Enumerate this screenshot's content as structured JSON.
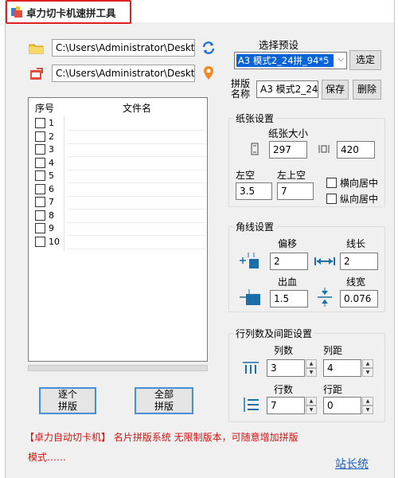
{
  "window": {
    "title": "卓力切卡机速拼工具"
  },
  "paths": {
    "input": "C:\\Users\\Administrator\\Desktop\\1",
    "output": "C:\\Users\\Administrator\\Desktop\\2"
  },
  "preset": {
    "label": "选择预设",
    "selected": "A3 模式2_24拼_94*5",
    "select_button": "选定",
    "name_label_1": "拼版",
    "name_label_2": "名称",
    "name_value": "A3 模式2_24",
    "save_button": "保存",
    "delete_button": "删除"
  },
  "file_list": {
    "col_index": "序号",
    "col_filename": "文件名",
    "rows": [
      "1",
      "2",
      "3",
      "4",
      "5",
      "6",
      "7",
      "8",
      "9",
      "10"
    ]
  },
  "paper": {
    "group_label": "纸张设置",
    "size_label": "纸张大小",
    "height": "297",
    "width": "420",
    "left_margin_label": "左空",
    "top_margin_label": "左上空",
    "left_margin": "3.5",
    "top_margin": "7",
    "center_h_label": "横向居中",
    "center_v_label": "纵向居中"
  },
  "corner": {
    "group_label": "角线设置",
    "offset_label": "偏移",
    "offset": "2",
    "length_label": "线长",
    "length": "2",
    "bleed_label": "出血",
    "bleed": "1.5",
    "width_label": "线宽",
    "width": "0.076"
  },
  "grid": {
    "group_label": "行列数及间距设置",
    "cols_label": "列数",
    "cols": "3",
    "col_gap_label": "列距",
    "col_gap": "4",
    "rows_label": "行数",
    "rows": "7",
    "row_gap_label": "行距",
    "row_gap": "0"
  },
  "actions": {
    "single_1": "逐个",
    "single_2": "拼版",
    "all_1": "全部",
    "all_2": "拼版"
  },
  "footer": {
    "line1": "【卓力自动切卡机】 名片拼版系统 无限制版本，可随意增加拼版",
    "line2": "模式……",
    "link": "站长统"
  },
  "colors": {
    "accent": "#0a64d8",
    "highlight_red": "#e02020",
    "footer_red": "#d01414",
    "link_blue": "#1a5fc0"
  },
  "icons": [
    "app-icon",
    "folder-icon",
    "refresh-icon",
    "export-icon",
    "location-pin-icon",
    "paper-height-icon",
    "paper-width-icon",
    "offset-icon",
    "line-length-icon",
    "bleed-icon",
    "line-width-icon",
    "columns-icon",
    "rows-icon"
  ]
}
